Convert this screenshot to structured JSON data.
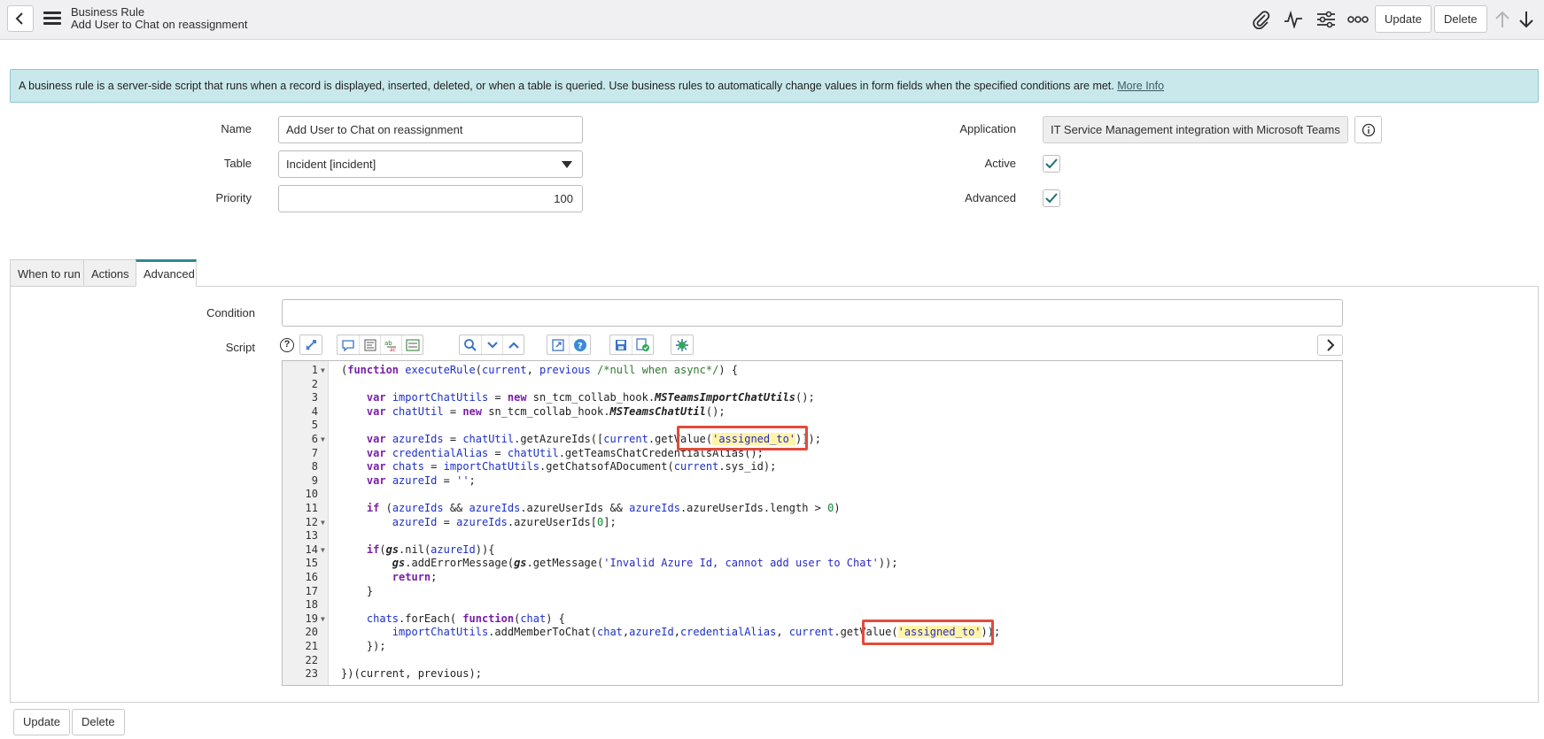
{
  "header": {
    "title": "Business Rule",
    "subtitle": "Add User to Chat on reassignment",
    "icons": [
      "paperclip-icon",
      "activity-icon",
      "sliders-icon",
      "more-icon"
    ],
    "update_label": "Update",
    "delete_label": "Delete"
  },
  "banner": {
    "text": "A business rule is a server-side script that runs when a record is displayed, inserted, deleted, or when a table is queried. Use business rules to automatically change values in form fields when the specified conditions are met.",
    "link": "More Info"
  },
  "form": {
    "name_label": "Name",
    "name_value": "Add User to Chat on reassignment",
    "table_label": "Table",
    "table_value": "Incident [incident]",
    "priority_label": "Priority",
    "priority_value": "100",
    "application_label": "Application",
    "application_value": "IT Service Management integration with Microsoft Teams",
    "active_label": "Active",
    "active_checked": true,
    "advanced_label": "Advanced",
    "advanced_checked": true
  },
  "tabs": [
    {
      "label": "When to run",
      "active": false
    },
    {
      "label": "Actions",
      "active": false
    },
    {
      "label": "Advanced",
      "active": true
    }
  ],
  "advanced": {
    "condition_label": "Condition",
    "condition_value": "",
    "script_label": "Script"
  },
  "script_lines": [
    "(function executeRule(current, previous /*null when async*/) {",
    "",
    "    var importChatUtils = new sn_tcm_collab_hook.MSTeamsImportChatUtils();",
    "    var chatUtil = new sn_tcm_collab_hook.MSTeamsChatUtil();",
    "",
    "    var azureIds = chatUtil.getAzureIds([current.getValue('assigned_to')]);",
    "    var credentialAlias = chatUtil.getTeamsChatCredentialsAlias();",
    "    var chats = importChatUtils.getChatsofADocument(current.sys_id);",
    "    var azureId = '';",
    "",
    "    if (azureIds && azureIds.azureUserIds && azureIds.azureUserIds.length > 0)",
    "        azureId = azureIds.azureUserIds[0];",
    "",
    "    if(gs.nil(azureId)){",
    "        gs.addErrorMessage(gs.getMessage('Invalid Azure Id, cannot add user to Chat'));",
    "        return;",
    "    }",
    "",
    "    chats.forEach( function(chat) {",
    "        importChatUtils.addMemberToChat(chat,azureId,credentialAlias, current.getValue('assigned_to'));",
    "    });",
    "",
    "})(current, previous);"
  ],
  "footer": {
    "update_label": "Update",
    "delete_label": "Delete"
  }
}
